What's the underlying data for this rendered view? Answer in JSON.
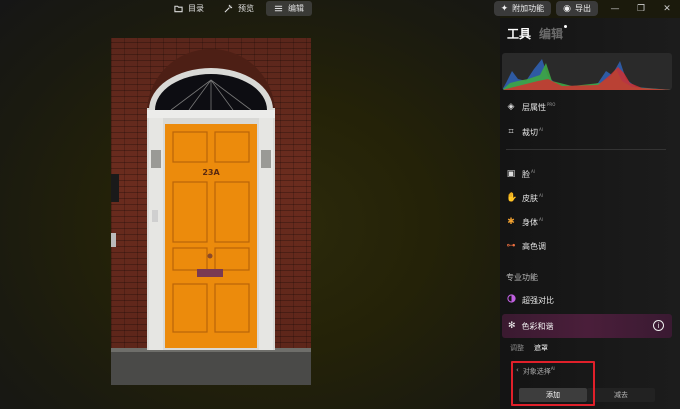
{
  "top_bar": {
    "tabs": [
      {
        "label": "目录",
        "icon": "folder-icon"
      },
      {
        "label": "预览",
        "icon": "magic-wand-icon"
      },
      {
        "label": "编辑",
        "icon": "sliders-icon"
      }
    ],
    "addon_label": "附加功能",
    "export_label": "导出",
    "window_controls": {
      "minimize": "—",
      "restore": "❐",
      "close": "✕"
    }
  },
  "panel": {
    "tabs": {
      "tools": "工具",
      "edit": "编辑"
    },
    "tools": [
      {
        "label": "层属性",
        "badge": "PRO",
        "icon": "layers-icon",
        "glyph": "◈"
      },
      {
        "label": "裁切",
        "badge": "AI",
        "icon": "crop-icon",
        "glyph": "⌗"
      },
      {
        "label": "脸",
        "badge": "AI",
        "icon": "face-icon",
        "glyph": "▣"
      },
      {
        "label": "皮肤",
        "badge": "AI",
        "icon": "skin-icon",
        "glyph": "✋"
      },
      {
        "label": "身体",
        "badge": "AI",
        "icon": "body-icon",
        "glyph": "✱"
      },
      {
        "label": "高色调",
        "badge": "",
        "icon": "high-key-icon",
        "glyph": "⊶"
      }
    ],
    "pro_section_title": "专业功能",
    "super_contrast": {
      "label": "超强对比",
      "icon": "contrast-icon"
    },
    "color_harmony": {
      "label": "色彩和谐",
      "icon": "gear-icon"
    },
    "subtabs": {
      "adjust": "调整",
      "mask": "遮罩"
    },
    "object_select": {
      "label": "对象选择",
      "badge": "AI"
    },
    "add_label": "添加",
    "subtract_label": "减去"
  },
  "photo": {
    "house_number": "23A"
  },
  "colors": {
    "accent_red": "#e0202a",
    "door_orange": "#ec8b0c",
    "brick": "#6b2c1e"
  }
}
